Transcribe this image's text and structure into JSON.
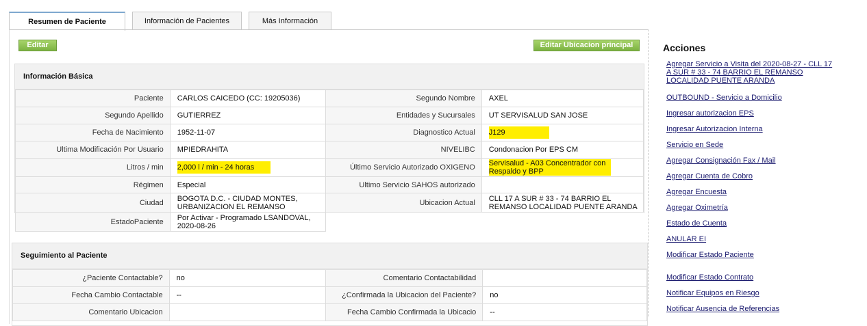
{
  "tabs": [
    "Resumen de Paciente",
    "Información de Pacientes",
    "Más Información"
  ],
  "buttons": {
    "editar": "Editar",
    "editar_ubicacion": "Editar Ubicacion principal"
  },
  "basic": {
    "title": "Información Básica",
    "rows": [
      {
        "l1": "Paciente",
        "v1": "CARLOS CAICEDO (CC: 19205036)",
        "l2": "Segundo Nombre",
        "v2": "AXEL"
      },
      {
        "l1": "Segundo Apellido",
        "v1": "GUTIERREZ",
        "l2": "Entidades y Sucursales",
        "v2": "UT SERVISALUD SAN JOSE"
      },
      {
        "l1": "Fecha de Nacimiento",
        "v1": "1952-11-07",
        "l2": "Diagnostico Actual",
        "v2": "J129"
      },
      {
        "l1": "Ultima Modificación Por Usuario",
        "v1": "MPIEDRAHITA",
        "l2": "NIVELIBC",
        "v2": "Condonacion Por EPS CM"
      },
      {
        "l1": "Litros / min",
        "v1": "2,000 l / min - 24 horas",
        "l2": "Último Servicio Autorizado OXIGENO",
        "v2": "Servisalud - A03 Concentrador con Respaldo y BPP"
      },
      {
        "l1": "Régimen",
        "v1": "Especial",
        "l2": "Ultimo Servicio SAHOS autorizado",
        "v2": ""
      },
      {
        "l1": "Ciudad",
        "v1": "BOGOTA D.C. - CIUDAD MONTES, URBANIZACION EL REMANSO",
        "l2": "Ubicacion Actual",
        "v2": "CLL 17 A SUR # 33 - 74 BARRIO EL REMANSO LOCALIDAD PUENTE ARANDA"
      },
      {
        "l1": "EstadoPaciente",
        "v1": "Por Activar - Programado LSANDOVAL, 2020-08-26"
      }
    ]
  },
  "tracking": {
    "title": "Seguimiento al Paciente",
    "rows": [
      {
        "l1": "¿Paciente Contactable?",
        "v1": "no",
        "l2": "Comentario Contactabilidad",
        "v2": ""
      },
      {
        "l1": "Fecha Cambio Contactable",
        "v1": "--",
        "l2": "¿Confirmada la Ubicacion del Paciente?",
        "v2": "no"
      },
      {
        "l1": "Comentario Ubicacion",
        "v1": "",
        "l2": "Fecha Cambio Confirmada la Ubicacio",
        "v2": "--"
      }
    ]
  },
  "actions": {
    "title": "Acciones",
    "items": [
      "Agregar Servicio a Visita del 2020-08-27 - CLL 17 A SUR # 33 - 74 BARRIO EL REMANSO LOCALIDAD PUENTE ARANDA",
      "OUTBOUND - Servicio a Domicilio",
      "Ingresar autorizacion EPS",
      "Ingresar Autorizacion Interna",
      "Servicio en Sede",
      "Agregar Consignación Fax / Mail",
      "Agregar Cuenta de Cobro",
      "Agregar Encuesta",
      "Agregar Oximetría",
      "Estado de Cuenta",
      "ANULAR EI",
      "Modificar Estado Paciente",
      "Modificar Estado Contrato",
      "Notificar Equipos en Riesgo",
      "Notificar Ausencia de Referencias"
    ]
  },
  "colors": {
    "highlight": "#ffee00",
    "button_green": "#8cc152",
    "link": "#1a1a6e"
  }
}
